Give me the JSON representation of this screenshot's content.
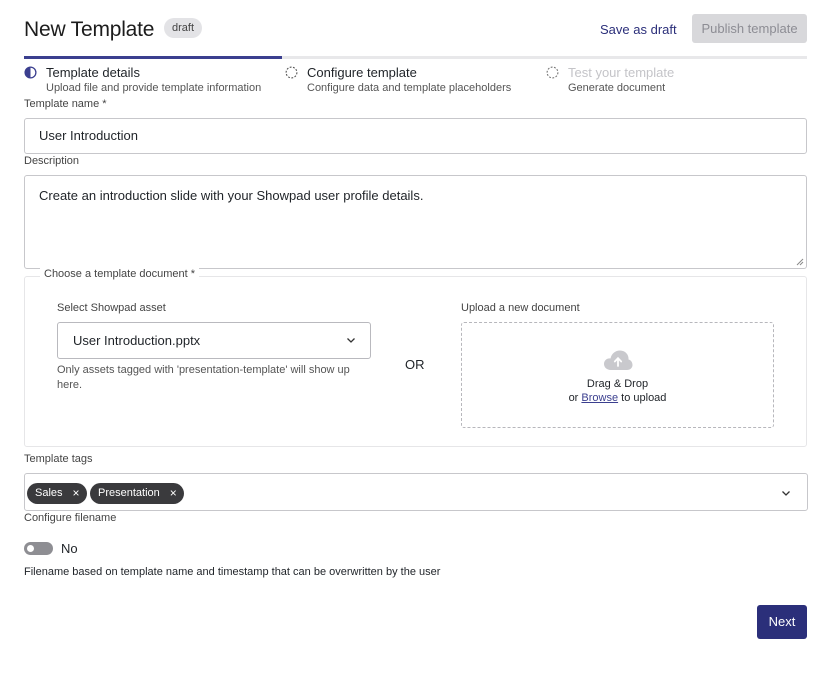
{
  "header": {
    "title": "New Template",
    "badge": "draft",
    "save_draft_label": "Save as draft",
    "publish_label": "Publish template"
  },
  "stepper": {
    "progress_fraction": 0.33,
    "steps": [
      {
        "title": "Template details",
        "subtitle": "Upload file and provide template information",
        "state": "active"
      },
      {
        "title": "Configure template",
        "subtitle": "Configure data and template placeholders",
        "state": "pending"
      },
      {
        "title": "Test your template",
        "subtitle": "Generate document",
        "state": "disabled"
      }
    ]
  },
  "form": {
    "template_name": {
      "label": "Template name *",
      "value": "User Introduction"
    },
    "description": {
      "label": "Description",
      "value": "Create an introduction slide with your Showpad user profile details."
    },
    "document": {
      "legend": "Choose a template document *",
      "asset_label": "Select Showpad asset",
      "asset_value": "User Introduction.pptx",
      "asset_hint": "Only assets tagged with 'presentation-template' will show up here.",
      "or_label": "OR",
      "upload_label": "Upload a new document",
      "drop_title": "Drag & Drop",
      "drop_prefix": "or",
      "browse_label": "Browse",
      "drop_suffix": "to upload"
    },
    "tags": {
      "label": "Template tags",
      "items": [
        "Sales",
        "Presentation"
      ],
      "remove_glyph": "×"
    },
    "filename": {
      "label": "Configure filename",
      "toggle_state": "No",
      "help": "Filename based on template name and timestamp that can be overwritten by the user"
    }
  },
  "footer": {
    "next_label": "Next"
  },
  "colors": {
    "accent": "#2b2f7a",
    "progress": "#3b3f8f",
    "chip": "#3a3a3d",
    "disabled": "#d8d8db"
  },
  "icons": [
    "half-circle-step-icon",
    "dashed-circle-step-icon",
    "chevron-down-icon",
    "cloud-upload-icon",
    "close-icon",
    "resize-handle-icon"
  ]
}
